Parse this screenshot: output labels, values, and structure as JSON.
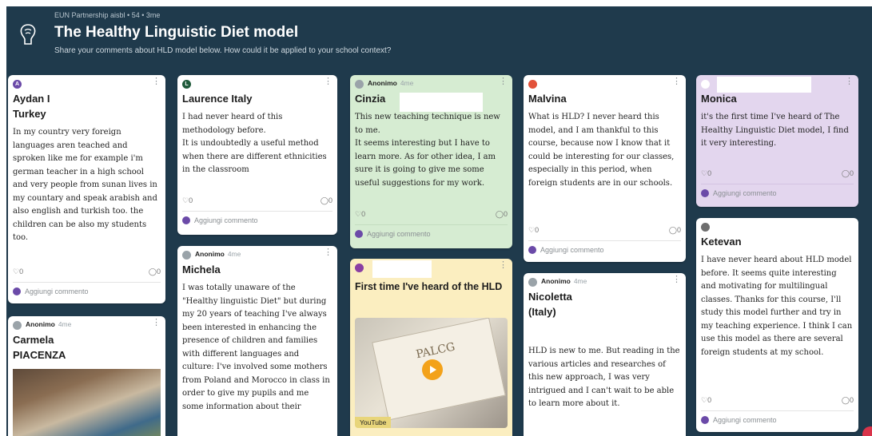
{
  "header": {
    "meta": "EUN Partnership aisbl • 54 • 3me",
    "title": "The Healthy Linguistic Diet model",
    "subtitle": "Share your comments about HLD model below. How could it be applied to your school context?"
  },
  "ui": {
    "add_comment": "Aggiungi commento",
    "like_count": "0",
    "comment_count": "0",
    "more": "⋮",
    "anon_label": "Anonimo",
    "anon_time": "4me"
  },
  "colors": {
    "board": "#1f3a4c",
    "card_white": "#ffffff",
    "card_green": "#d6ecd2",
    "card_lilac": "#e3d6ee",
    "card_yellow": "#fbeec0",
    "avatar_purple": "#6b4aa8"
  },
  "cards": {
    "aydan": {
      "avatar_letter": "A",
      "name_line1": "Aydan I",
      "name_line2": "Turkey",
      "body": "In my country very foreign languages aren teached and sproken like me for example i'm german teacher in a high school and very people from sunan lives in my countary and speak arabish and also english and turkish too. the children can be also my students too."
    },
    "carmela": {
      "name_line1": "Carmela",
      "name_line2": "PIACENZA"
    },
    "laurence": {
      "avatar_letter": "L",
      "name": "Laurence Italy",
      "body": "I had never heard of this methodology before.\nIt is undoubtedly a useful method when there are different ethnicities in the classroom"
    },
    "michela": {
      "name": "Michela",
      "body": "I was totally unaware of the \"Healthy linguistic Diet\" but during my 20 years of teaching I've always been interested in enhancing the presence of children and families with different languages and culture: I've involved some mothers from Poland and Morocco in class in order to give my pupils and me some information about their"
    },
    "cinzia": {
      "name": "Cinzia",
      "body": "This new teaching technique is new to me.\nIt seems interesting but I have to learn more. As for other idea, I am sure it is going to give me some useful suggestions for my work."
    },
    "hld_video": {
      "title": "First time I've heard of the HLD",
      "video_label": "YouTube",
      "book_text": "PALCG"
    },
    "malvina": {
      "name": "Malvina",
      "body": "What is HLD? I never heard this model, and I am thankful to this course, because now I know that it could be interesting for our classes, especially in this period, when foreign students are in our schools."
    },
    "nicoletta": {
      "name_line1": "Nicoletta",
      "name_line2": "(Italy)",
      "body": "HLD is new to me. But reading in the various articles and researches of this new approach, I was very intrigued and I can't wait to be able to learn more about it."
    },
    "monica": {
      "name": "Monica",
      "body": "it's the first time I've heard of The Healthy Linguistic Diet model, I find it very interesting."
    },
    "ketevan": {
      "name": "Ketevan",
      "body": "I have never heard about HLD model before. It seems quite interesting and motivating for multilingual classes. Thanks for this course, I'll study this model further and try in my teaching experience. I think I can use this model as there are several foreign students at my school."
    }
  }
}
